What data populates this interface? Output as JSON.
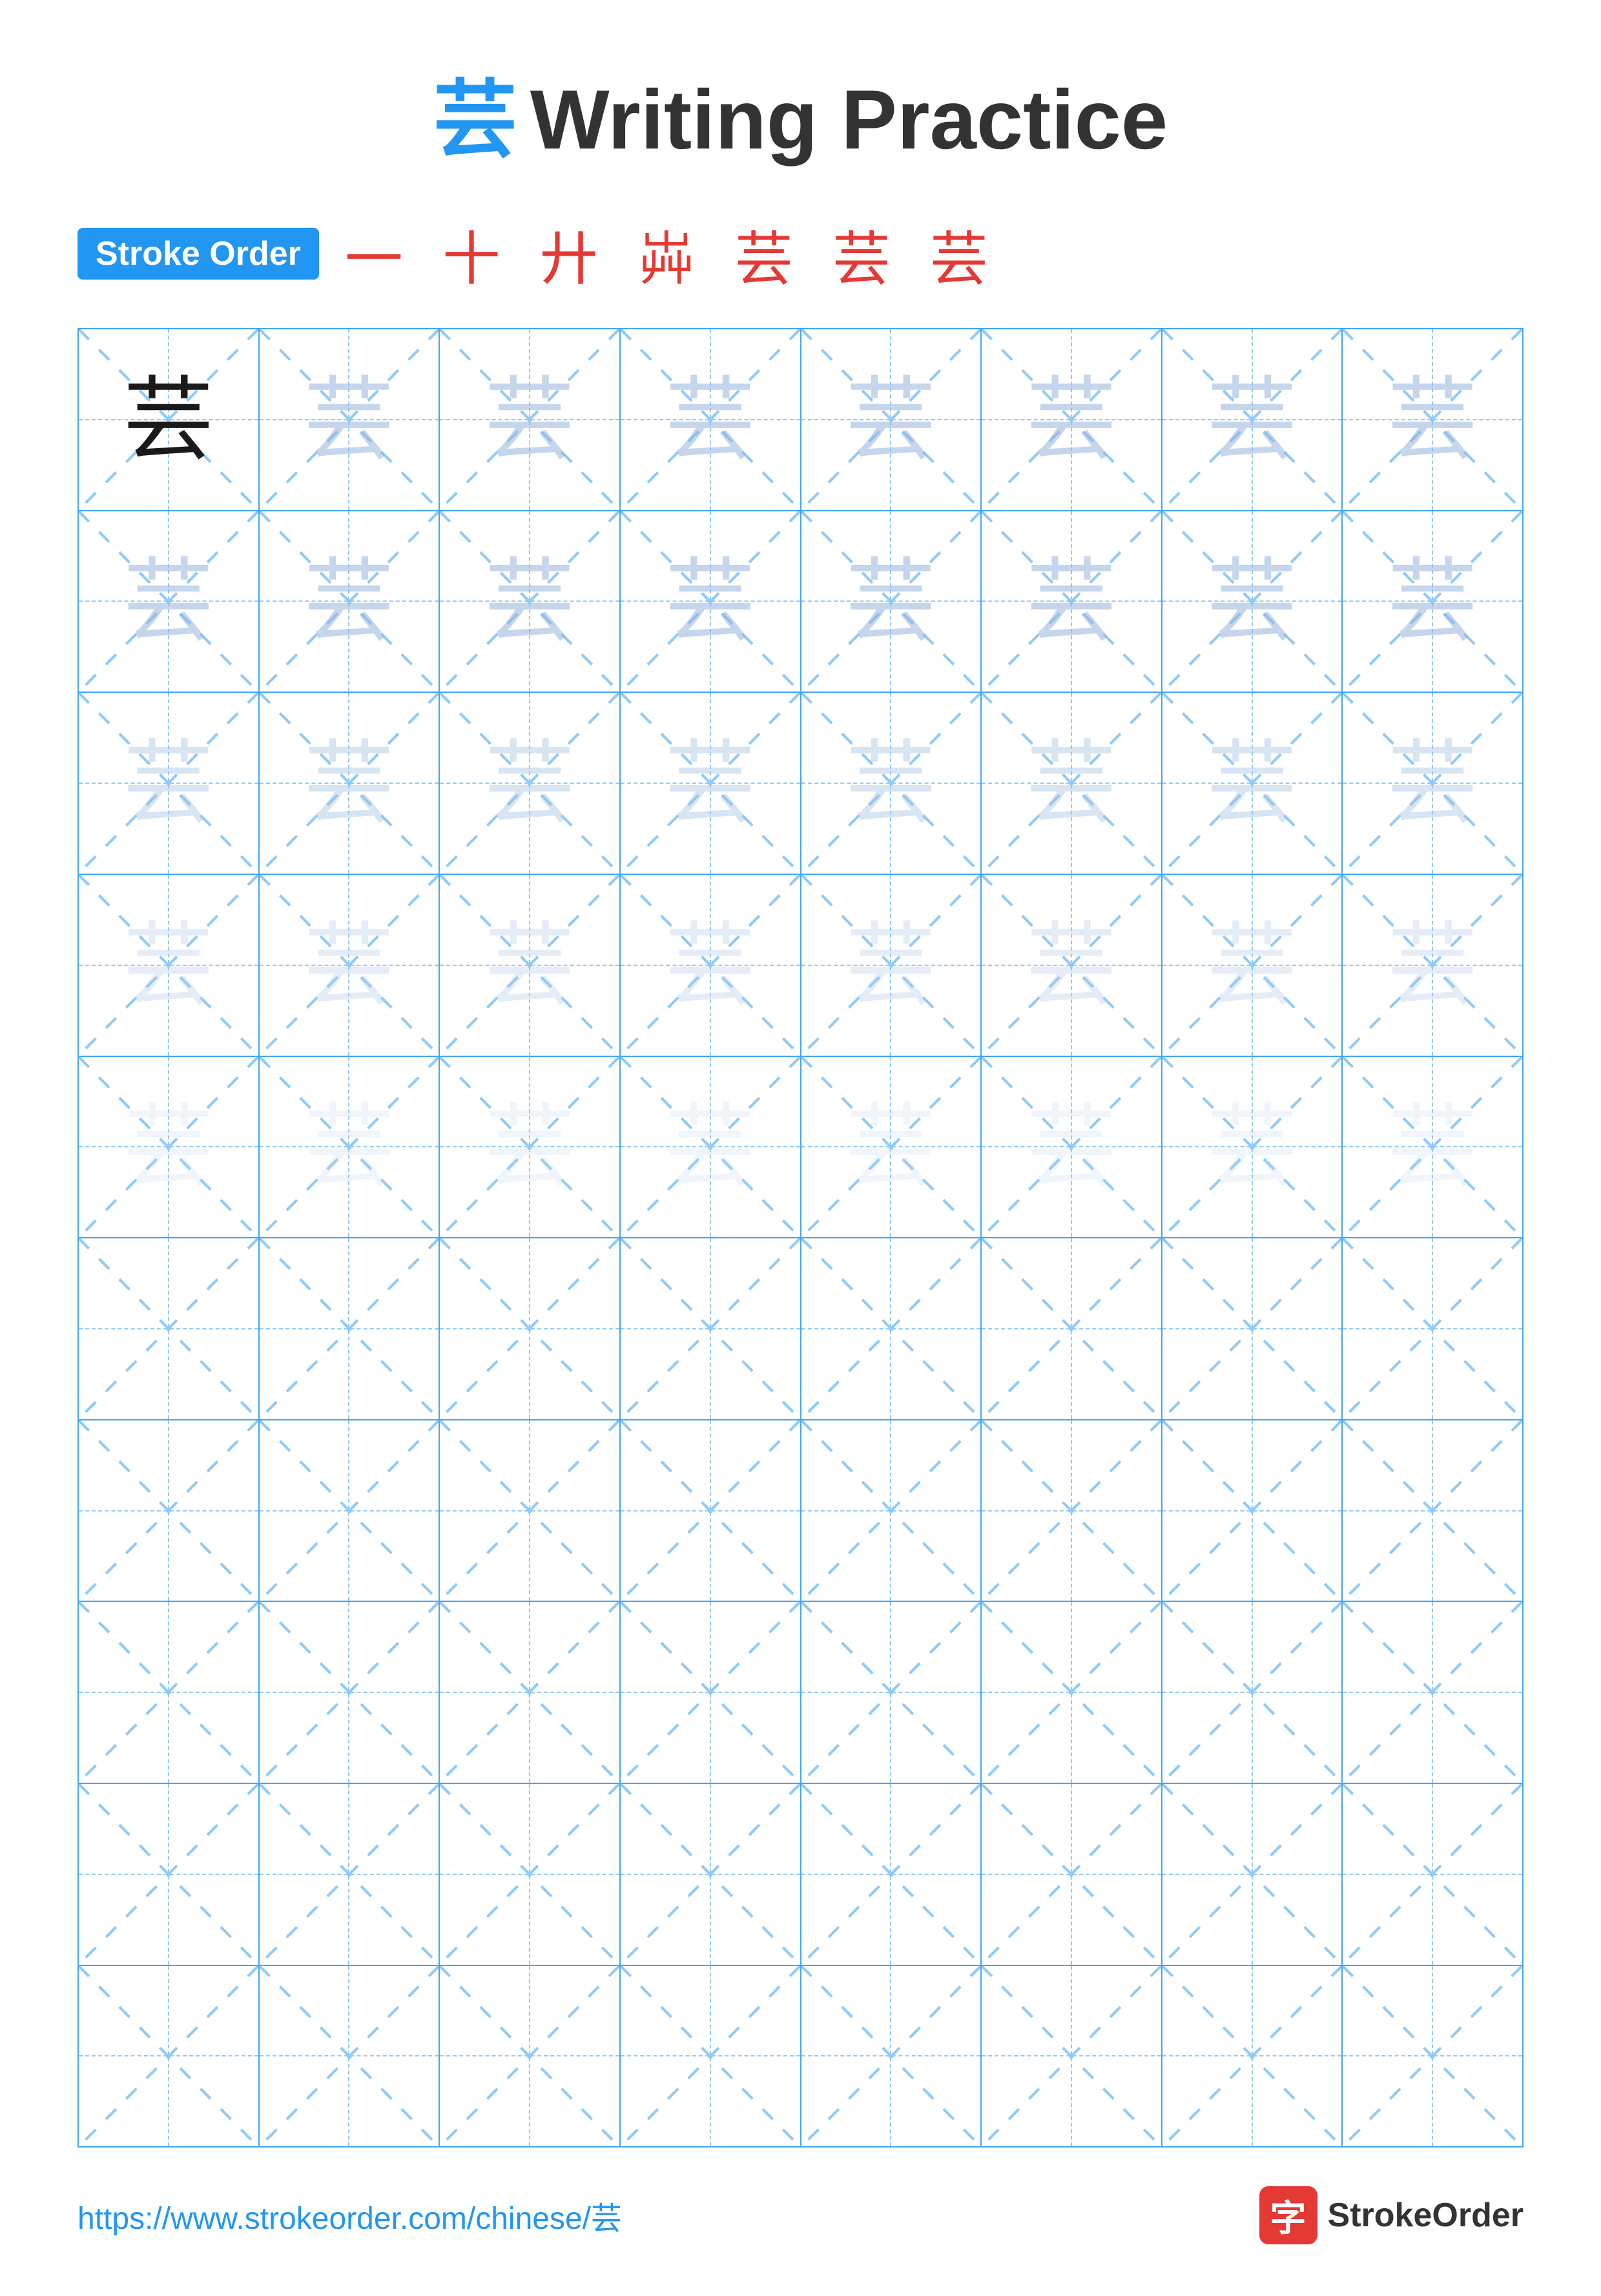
{
  "title": {
    "char": "芸",
    "text": "Writing Practice"
  },
  "stroke_order": {
    "badge": "Stroke Order",
    "chars": "一 十 廾 芔 芸 芸 芸"
  },
  "grid": {
    "cols": 8,
    "rows": [
      {
        "chars": [
          "dark",
          "light1",
          "light1",
          "light1",
          "light1",
          "light1",
          "light1",
          "light1"
        ]
      },
      {
        "chars": [
          "light1",
          "light1",
          "light1",
          "light1",
          "light1",
          "light1",
          "light1",
          "light1"
        ]
      },
      {
        "chars": [
          "light2",
          "light2",
          "light2",
          "light2",
          "light2",
          "light2",
          "light2",
          "light2"
        ]
      },
      {
        "chars": [
          "light3",
          "light3",
          "light3",
          "light3",
          "light3",
          "light3",
          "light3",
          "light3"
        ]
      },
      {
        "chars": [
          "light4",
          "light4",
          "light4",
          "light4",
          "light4",
          "light4",
          "light4",
          "light4"
        ]
      },
      {
        "chars": [
          "empty",
          "empty",
          "empty",
          "empty",
          "empty",
          "empty",
          "empty",
          "empty"
        ]
      },
      {
        "chars": [
          "empty",
          "empty",
          "empty",
          "empty",
          "empty",
          "empty",
          "empty",
          "empty"
        ]
      },
      {
        "chars": [
          "empty",
          "empty",
          "empty",
          "empty",
          "empty",
          "empty",
          "empty",
          "empty"
        ]
      },
      {
        "chars": [
          "empty",
          "empty",
          "empty",
          "empty",
          "empty",
          "empty",
          "empty",
          "empty"
        ]
      },
      {
        "chars": [
          "empty",
          "empty",
          "empty",
          "empty",
          "empty",
          "empty",
          "empty",
          "empty"
        ]
      }
    ],
    "char": "芸"
  },
  "footer": {
    "url": "https://www.strokeorder.com/chinese/芸",
    "logo_char": "字",
    "logo_text": "StrokeOrder"
  }
}
